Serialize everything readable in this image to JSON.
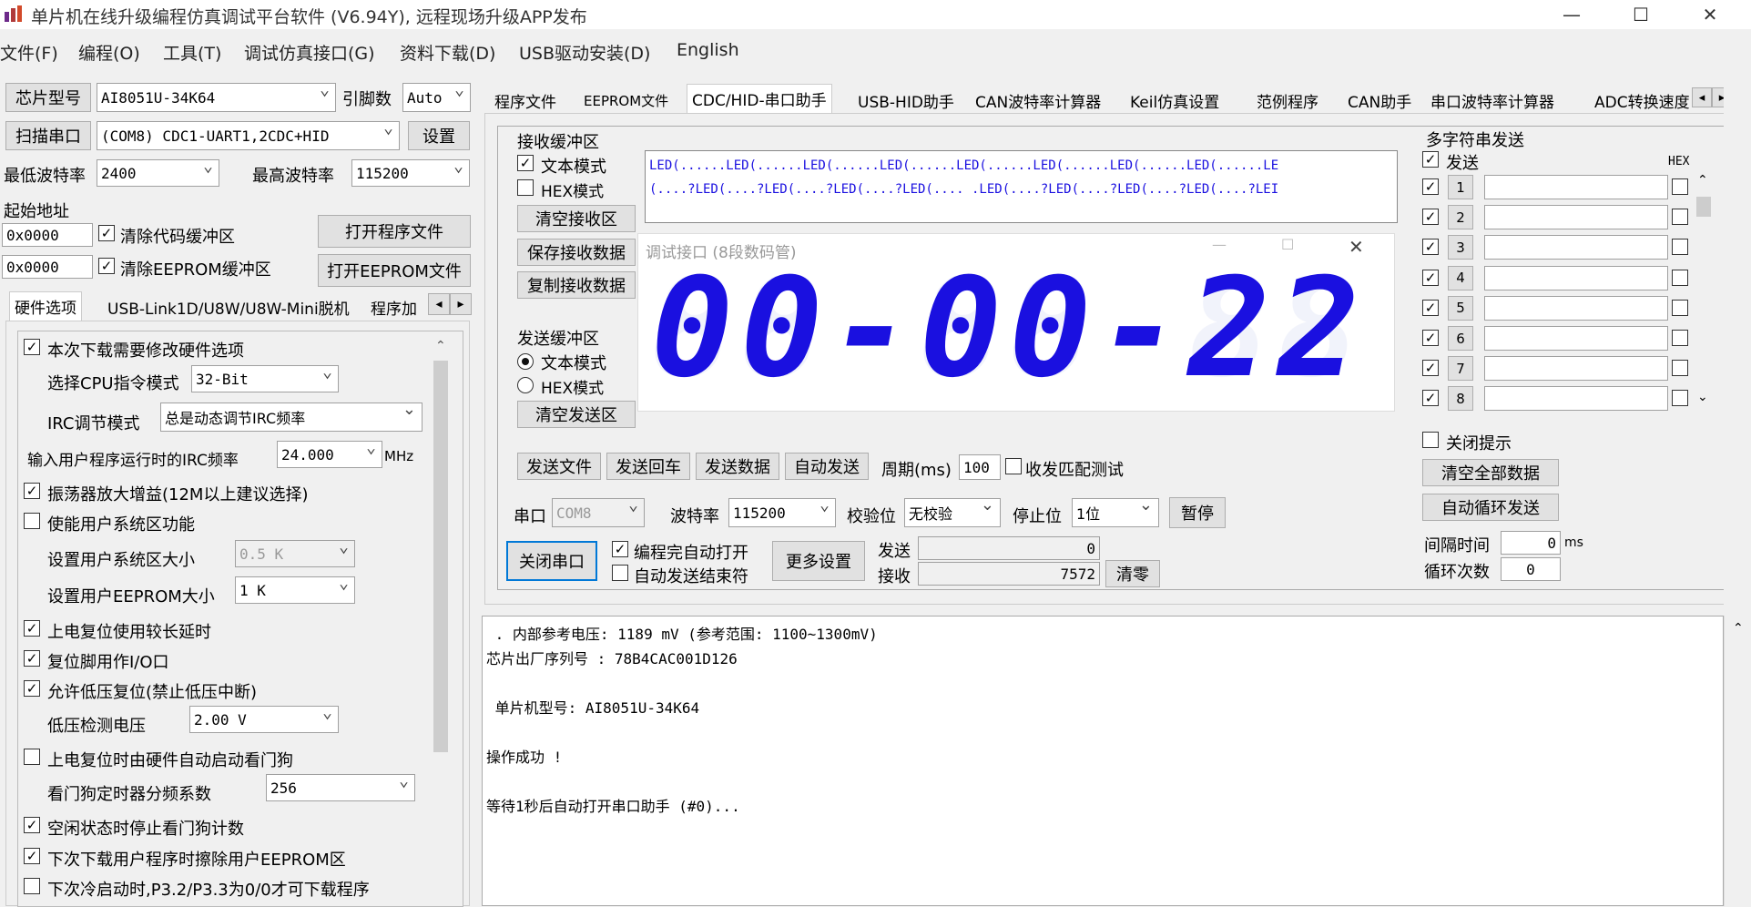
{
  "window": {
    "title": "单片机在线升级编程仿真调试平台软件 (V6.94Y), 远程现场升级APP发布",
    "min": "—",
    "max": "☐",
    "close": "✕"
  },
  "menu": [
    "文件(F)",
    "编程(O)",
    "工具(T)",
    "调试仿真接口(G)",
    "资料下载(D)",
    "USB驱动安装(D)",
    "English"
  ],
  "left": {
    "chip_btn": "芯片型号",
    "chip_value": "AI8051U-34K64",
    "pin_label": "引脚数",
    "pin_value": "Auto",
    "scan_btn": "扫描串口",
    "port_value": "(COM8) CDC1-UART1,2CDC+HID",
    "settings_btn": "设置",
    "min_baud_label": "最低波特率",
    "min_baud": "2400",
    "max_baud_label": "最高波特率",
    "max_baud": "115200",
    "start_addr_label": "起始地址",
    "addr1": "0x0000",
    "clear_code": "清除代码缓冲区",
    "open_prog": "打开程序文件",
    "addr2": "0x0000",
    "clear_eeprom": "清除EEPROM缓冲区",
    "open_eeprom": "打开EEPROM文件",
    "tabs": [
      "硬件选项",
      "USB-Link1D/U8W/U8W-Mini脱机",
      "程序加"
    ],
    "tab_prev": "◂",
    "tab_next": "▸",
    "opts": {
      "modify_hw": "本次下载需要修改硬件选项",
      "cpu_mode_label": "选择CPU指令模式",
      "cpu_mode": "32-Bit",
      "irc_label": "IRC调节模式",
      "irc_mode": "总是动态调节IRC频率",
      "irc_freq_label": "输入用户程序运行时的IRC频率",
      "irc_freq": "24.000",
      "mhz": "MHz",
      "osc_gain": "振荡器放大增益(12M以上建议选择)",
      "user_sys": "使能用户系统区功能",
      "sys_size_label": "设置用户系统区大小",
      "sys_size": "0.5 K",
      "eeprom_size_label": "设置用户EEPROM大小",
      "eeprom_size": "1  K",
      "long_reset": "上电复位使用较长延时",
      "reset_io": "复位脚用作I/O口",
      "lvr": "允许低压复位(禁止低压中断)",
      "lv_label": "低压检测电压",
      "lv_value": "2.00 V",
      "wdt_auto": "上电复位时由硬件自动启动看门狗",
      "wdt_div_label": "看门狗定时器分频系数",
      "wdt_div": "256",
      "wdt_idle": "空闲状态时停止看门狗计数",
      "erase_eeprom": "下次下载用户程序时擦除用户EEPROM区",
      "cold_boot": "下次冷启动时,P3.2/P3.3为0/0才可下载程序"
    }
  },
  "right_tabs": [
    "程序文件",
    "EEPROM文件",
    "CDC/HID-串口助手",
    "USB-HID助手",
    "CAN波特率计算器",
    "Keil仿真设置",
    "范例程序",
    "CAN助手",
    "串口波特率计算器",
    "ADC转换速度"
  ],
  "serial": {
    "recv_title": "接收缓冲区",
    "text_mode": "文本模式",
    "hex_mode": "HEX模式",
    "clear_recv": "清空接收区",
    "save_recv": "保存接收数据",
    "copy_recv": "复制接收数据",
    "recv_line1": "LED(......LED(......LED(......LED(......LED(......LED(......LED(......LED(......LE",
    "recv_line2": "(....?LED(....?LED(....?LED(....?LED(.... .LED(....?LED(....?LED(....?LED(....?LEI",
    "send_title": "发送缓冲区",
    "send_text_mode": "文本模式",
    "send_hex_mode": "HEX模式",
    "clear_send": "清空发送区",
    "send_file": "发送文件",
    "send_cr": "发送回车",
    "send_data": "发送数据",
    "auto_send": "自动发送",
    "period_label": "周期(ms)",
    "period": "100",
    "match_test": "收发匹配测试",
    "port_label": "串口",
    "port": "COM8",
    "baud_label": "波特率",
    "baud": "115200",
    "parity_label": "校验位",
    "parity": "无校验",
    "stop_label": "停止位",
    "stop": "1位",
    "pause": "暂停",
    "close_port": "关闭串口",
    "auto_open": "编程完自动打开",
    "auto_end": "自动发送结束符",
    "more": "更多设置",
    "sent_label": "发送",
    "sent": "0",
    "recv_label": "接收",
    "recv": "7572",
    "reset": "清零"
  },
  "popup": {
    "title": "调试接口 (8段数码管)",
    "digits": "00-00-22",
    "min": "—",
    "max": "☐",
    "close": "✕"
  },
  "multi": {
    "title": "多字符串发送",
    "send": "发送",
    "hex": "HEX",
    "rows": [
      "1",
      "2",
      "3",
      "4",
      "5",
      "6",
      "7",
      "8"
    ],
    "close_tip": "关闭提示",
    "clear_all": "清空全部数据",
    "auto_loop": "自动循环发送",
    "interval_label": "间隔时间",
    "interval": "0",
    "ms": "ms",
    "loop_label": "循环次数",
    "loop": "0"
  },
  "log": [
    " . 内部参考电压: 1189 mV (参考范围: 1100~1300mV)",
    "芯片出厂序列号 : 78B4CAC001D126",
    "",
    " 单片机型号: AI8051U-34K64",
    "",
    "操作成功 !",
    "",
    "等待1秒后自动打开串口助手 (#0)..."
  ]
}
